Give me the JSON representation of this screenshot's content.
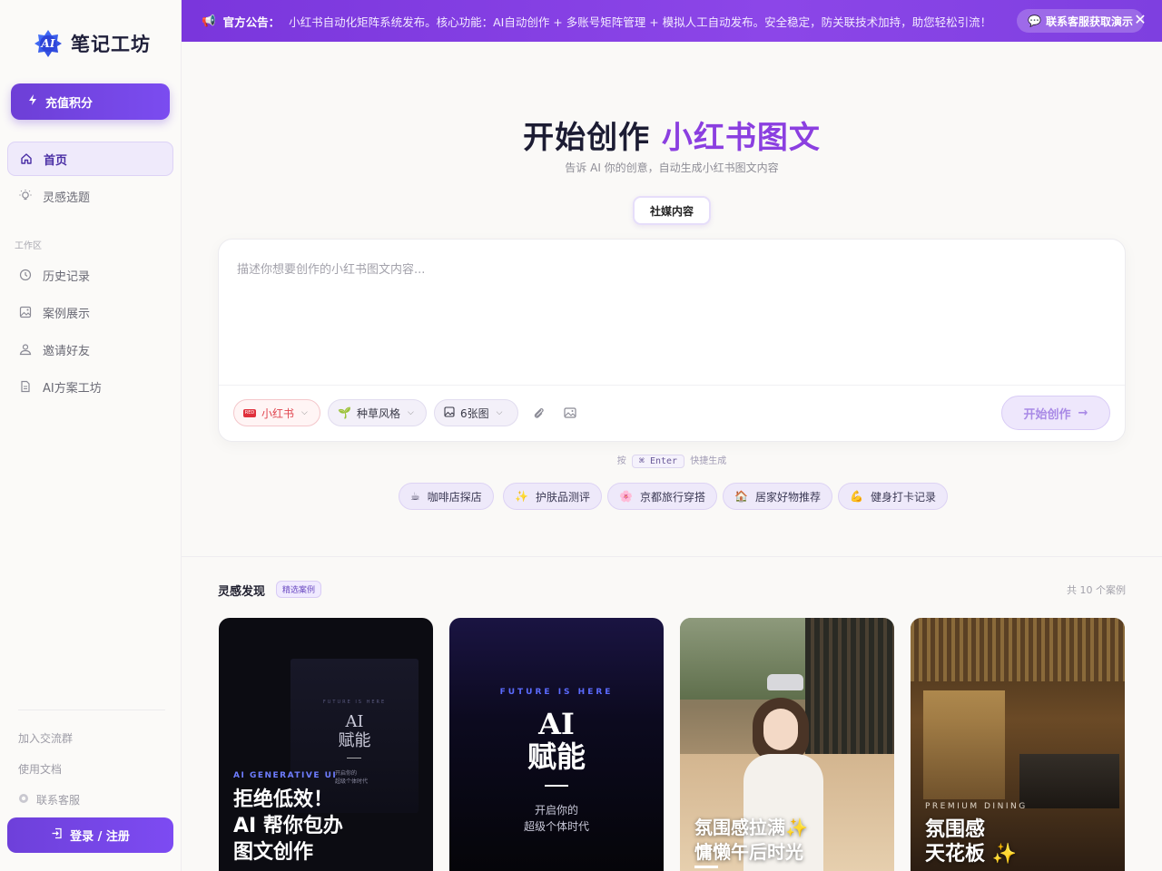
{
  "brand": {
    "name": "笔记工坊",
    "mark": "AI"
  },
  "sidebar": {
    "recharge_label": "充值积分",
    "nav_top": [
      {
        "label": "首页",
        "icon": "home-icon",
        "active": true
      },
      {
        "label": "灵感选题",
        "icon": "lightbulb-icon",
        "active": false
      }
    ],
    "section_label": "工作区",
    "nav_workspace": [
      {
        "label": "历史记录",
        "icon": "clock-icon"
      },
      {
        "label": "案例展示",
        "icon": "image-icon"
      },
      {
        "label": "邀请好友",
        "icon": "users-icon"
      },
      {
        "label": "AI方案工坊",
        "icon": "document-icon"
      }
    ],
    "join_group": "加入交流群",
    "docs": "使用文档",
    "support": "联系客服",
    "login_label": "登录 / 注册"
  },
  "announcement": {
    "label": "官方公告：",
    "text": "小红书自动化矩阵系统发布。核心功能：AI自动创作 + 多账号矩阵管理 + 模拟人工自动发布。安全稳定，防关联技术加持，助您轻松引流！",
    "contact_label": "联系客服获取演示"
  },
  "hero": {
    "title_main": "开始创作",
    "title_accent": "小红书图文",
    "subtitle": "告诉 AI 你的创意，自动生成小红书图文内容",
    "tab_label": "社媒内容"
  },
  "editor": {
    "placeholder": "描述你想要创作的小红书图文内容...",
    "platform_label": "小红书",
    "platform_badge": "RED",
    "style_label": "种草风格",
    "style_icon": "🌱",
    "count_label": "6张图",
    "start_label": "开始创作"
  },
  "shortcut": {
    "prefix": "按",
    "key": "⌘ Enter",
    "suffix": "快捷生成"
  },
  "suggestions": [
    {
      "icon": "☕",
      "label": "咖啡店探店"
    },
    {
      "icon": "✨",
      "label": "护肤品测评"
    },
    {
      "icon": "🌸",
      "label": "京都旅行穿搭"
    },
    {
      "icon": "🏠",
      "label": "居家好物推荐"
    },
    {
      "icon": "💪",
      "label": "健身打卡记录"
    }
  ],
  "discovery": {
    "title": "灵感发现",
    "badge": "精选案例",
    "count": "共 10 个案例"
  },
  "cards": [
    {
      "eyebrow": "AI GENERATIVE UI",
      "headline": [
        "拒绝低效！",
        "AI 帮你包办",
        "图文创作"
      ],
      "inner_top": "FUTURE IS HERE",
      "inner_title": [
        "AI",
        "赋能"
      ],
      "inner_sub": [
        "开启你的",
        "超级个体时代"
      ]
    },
    {
      "eyebrow": "FUTURE IS HERE",
      "headline": [
        "AI",
        "赋能"
      ],
      "sub": [
        "开启你的",
        "超级个体时代"
      ]
    },
    {
      "headline": [
        "氛围感拉满✨",
        "慵懒午后时光"
      ]
    },
    {
      "eyebrow": "PREMIUM DINING",
      "headline": [
        "氛围感",
        "天花板 ✨"
      ]
    }
  ],
  "colors": {
    "accent": "#7b4cf0",
    "announce": "#8a44e6",
    "title_accent": "#8b3fe0"
  }
}
